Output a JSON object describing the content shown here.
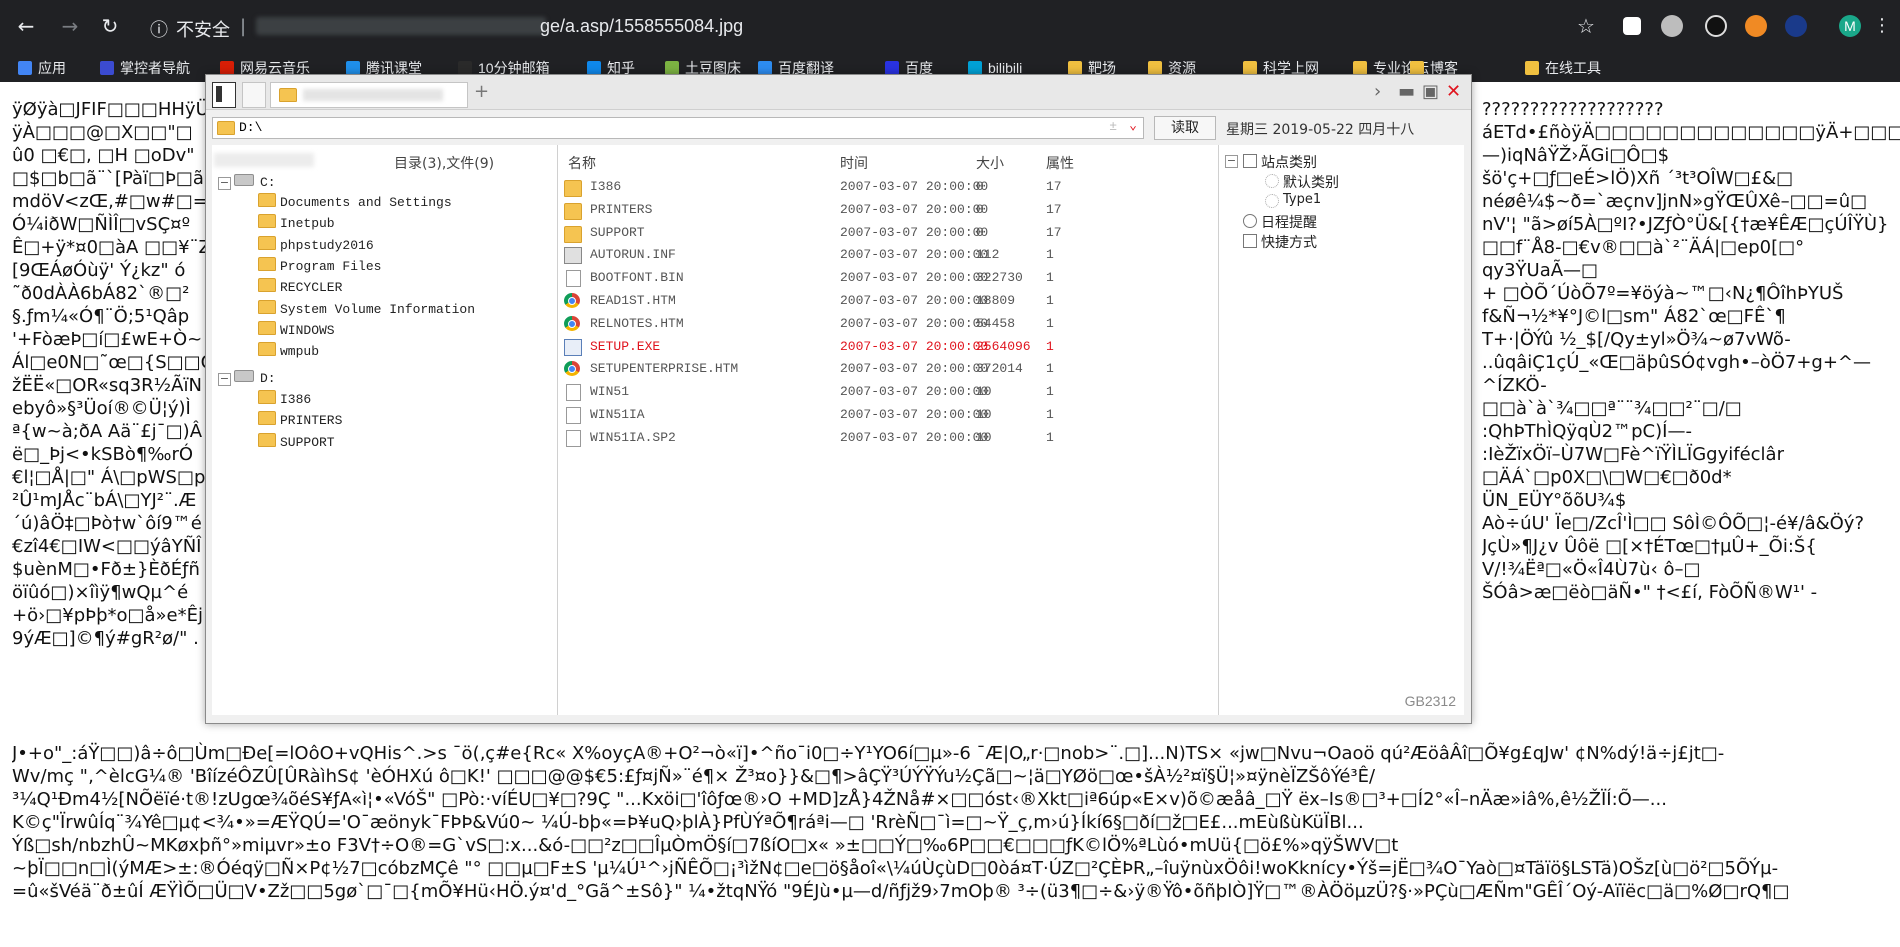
{
  "browser": {
    "security_label": "不安全",
    "url_visible": "ge/a.asp/1558555084.jpg",
    "profile_initial": "M"
  },
  "bookmarks": [
    {
      "label": "应用",
      "color": "#4285f4"
    },
    {
      "label": "掌控者导航",
      "color": "#3b4bd1"
    },
    {
      "label": "网易云音乐",
      "color": "#d81e06"
    },
    {
      "label": "腾讯课堂",
      "color": "#1f8fea"
    },
    {
      "label": "10分钟邮箱",
      "color": "#2a2a2a"
    },
    {
      "label": "知乎",
      "color": "#0f88eb"
    },
    {
      "label": "土豆图床",
      "color": "#7cb342"
    },
    {
      "label": "百度翻译",
      "color": "#2d8cf0"
    },
    {
      "label": "百度",
      "color": "#2932e1"
    },
    {
      "label": "bilibili",
      "color": "#00a1d6"
    },
    {
      "label": "靶场",
      "color": "#f0c040"
    },
    {
      "label": "资源",
      "color": "#f0c040"
    },
    {
      "label": "科学上网",
      "color": "#f0c040"
    },
    {
      "label": "专业论坛",
      "color": "#f0c040"
    },
    {
      "label": "博客",
      "color": "#f0c040"
    },
    {
      "label": "在线工具",
      "color": "#f0c040"
    }
  ],
  "garbled_left": [
    "ÿØÿà□JFIF□□□HHÿÜ",
    "ÿÀ□□□@□X□□\"□",
    "û0 □€□,  □H □oDv\"",
    "□$□b□ã¨`[Pàï□Þ□ã&",
    "mdöV<zŒ,#□w#□=",
    "Ó¼iðW□ÑÌÎ□vSÇ¤º",
    "Ê□+ÿ*¤0□àA □□¥¨Z",
    "[9ŒÁøÓùÿ' Ý¿kz\" ó",
    "˜ð0dÀÀ6bÁ82`®□²",
    "§.ƒm¼«Ó¶¨Ö;5¹Qâp",
    "'+FòæÞ□í□£wE+Ò~",
    "Ál□e0N□˜œ□{S□□Ó",
    "žËË«□OR«sq3R½ÃïN",
    "ebyô»§³Üoí®©Ü¦ý)Ì",
    "ª{w~à;ðA Aä¨£j¯□)Â",
    "ë□_Þj<•kSBò¶‰rÓ",
    "€l¦□Å|□\" Á\\□pWS□p",
    "²Û¹mJÅc¨bÁ\\□YJ²¨.Æ",
    "´ú)âÖ‡□Þò†w`ôí9™é",
    "€zî4€□IW<□□ýâYÑÎ",
    "$uènM□•Fð±}ÈðÉƒñ",
    "öïûó□)×îìÿ¶wQµ^é",
    "+ö›□¥pÞþ*o□å»e*Êj",
    "9ýÆ□]©¶ý#gR²ø/\" ."
  ],
  "garbled_right": [
    "???????????????????",
    "áETd•£ñòÿÄ□□□□□□□□□□□□□ÿÄ+□□□□□□",
    "—)iqNâŸŽ›ÃGi□Ô□$",
    "šö'ç+□ƒ□eÉ>lÖ)Xñ ´³t³OÎW□£&□",
    "",
    "néøê¼$~ð=`æçnv]jnN»gŸŒÛXê–□□=û□",
    "nV'¦ \"ã>øí5À□ºI?•JZƒÒ°Ü&[{†æ¥ÊÆ□çÚÎŸÙ}",
    "□□f¨Å8-□€v®□□à`²¨ÄÁ|□ep0[□°",
    "qy3ŸUaÃ—□",
    "+ □ÒÕ´ÚòÕ7º=¥öýà~™□‹N¿¶ÔîhÞYUŠ",
    "f&Ñ¬½*¥°J©l□sm\" Á82`œ□FÊ`¶",
    "",
    "T+·|ÖÝû ½_$[/Qy±yl»Ö¾~ø7vWõ-",
    "..ûqâiÇ1çÚ_«Œ□äþûSÓ¢vgh•–òÖ7+g+^—",
    "^ÍZKÖ-",
    "□□à`à`¾□□ª¨¨¾□□²¨□/□",
    ":QhÞThÌQÿqÙ2™pC)Í—-",
    ":IèŽïxÖï–Ù7W□Fè^ïŸÌLÏGgyiféclâr",
    "□ÄÁ`□p0X□\\□W□€□ð0d*",
    "ÜN_EÜY°õõU¾$",
    "Aò÷úU' Ïe□/ZcÎ'Ì□□ SôÌ©ÔÕ□¦-é¥/â&Öý?",
    "JçÙ»¶J¿v Ûôë □[×†ÉTœ□†µÛ+_Õi:Š{",
    "V/!¾Ëª□«Ö«Î4Ù7ù‹ ô–□",
    "ŠÓâ>æ□ëò□äÑ•\" †<£í, FòÕÑ®W¹' -"
  ],
  "garbled_bottom": [
    "J•+o\"_:áŸ□□)â÷ô□Ùm□Ðe[=lOôO+vQHis^.>s ¯ö(‚ç#e{Rc« X%oyçA®+O²¬ò«ï]•^ño¯i0□÷Y¹YO6í□µ»-6 ¯Æ|O„r·□nob>¨.□]...N)TS× «jw□Nvu¬Oaoö qú²ÆöâÂî□Õ¥g£qJw' ¢N%dý!ä÷j£jt□-",
    "Wv/mç \"‚^èlcG¼® 'BîízéÔZÛ[ÛRàìhS¢ 'èÓHXú ô□K!' □□□@@$€5:£ƒ¤jÑ»¨é¶× Ž³¤o}}&□¶>âÇŸ³ÚÝŸÝu½Çã□~¦ä□YØö□œ•šÀ½²¤ï§Ü¦»¤ÿnèÏZŠôÝé³Ê/",
    "³¼Q¹Ðm4½[NÕëïé·t®!zUgœ¾õéS¥ƒA«ì¦•«VóŠ\" □Pò:·víÉU□¥□?9Ç \"...Kxöi□'îôƒœ®›O +MD]zÅ}4ŽNå#×□□óst‹®Xkt□iª6úp«E×v)õ©æåâ_□Ÿ ëx–Is®□³+□Í2°«Î–nÄæ»iâ%,ê½ŽÏÍ:Õ—...",
    "K©ç\"ÏrwûÍq¨¾Yê□µ¢<¾•»=ÆŸQÚ='O¯æönyk¯FÞÞ&Vú0~ ¼Ú-bþ«=Þ¥uQ›þlÀ}PfÙÝªÕ¶ráªi—□ 'RrèÑ□¯ì=□~Ÿ_ç,m›ú}Íkí6§□ðí□ž□E£...mEùßùKüÏBl...",
    "Ýß□sh/nbzhÛ~MKøxþñ°»miµvr»±o F3V†÷O®=G`vS□:x...&ó-□□²z□□ÎµÒmÖ§í□7ßíO□x« »±□□Ý□‰6P□□€□□□ƒK©lÖ%ªLùó•mUü{□ö£%»qÿŠWV□t",
    "~þÏ□□n□Ì(ýMÆ>±:®Óéqÿ□Ñ×P¢½7□cóbzMÇê \"° □□µ□F±S 'µ¼Ú¹^›jÑÊÕ□¡³ìžN¢□e□ö§åoî«\\¼úÙçùD□0òá¤T·ÚZ□²ÇÈÞR„–îuÿnùxÖôi!woKknícy•Ýš=jË□¾O¯Yaò□¤Täïö§LSTä)OŠz[ù□ö²□5ÕÝµ-",
    "=û«šVéä¨ð±ûÍ ÆŸÌÕ□Ü□V•Zž□□5gø`□¯□{mÕ¥Hü‹HÖ.ý¤'d_°Gã^±Sô}\" ¼•žtqNŸó \"9ÉJù•µ—d/ñƒjž9›7mOþ® ³÷(ü3¶□÷&›ÿ®Ÿô•õñþlÒ]Ÿ□™®ÀÖöµzÜ?§·»PÇù□ÆÑm\"GÊÎ´Oý-Aïïëc□ä□%Ø□rQ¶□"
  ],
  "filemanager": {
    "address": "D:\\",
    "go_label": "读取",
    "date_text": "星期三  2019-05-22  四月十八",
    "tree_header": "目录(3),文件(9)",
    "columns": {
      "name": "名称",
      "time": "时间",
      "size": "大小",
      "attr": "属性"
    },
    "tree": {
      "c_drive": "C:",
      "c_children": [
        "Documents and Settings",
        "Inetpub",
        "phpstudy2016",
        "Program Files",
        "RECYCLER",
        "System Volume Information",
        "WINDOWS",
        "wmpub"
      ],
      "d_drive": "D:",
      "d_children": [
        "I386",
        "PRINTERS",
        "SUPPORT"
      ]
    },
    "files": [
      {
        "name": "I386",
        "time": "2007-03-07 20:00:00",
        "size": "0",
        "attr": "17",
        "icon": "folder-icon",
        "highlight": false
      },
      {
        "name": "PRINTERS",
        "time": "2007-03-07 20:00:00",
        "size": "0",
        "attr": "17",
        "icon": "folder-icon",
        "highlight": false
      },
      {
        "name": "SUPPORT",
        "time": "2007-03-07 20:00:00",
        "size": "0",
        "attr": "17",
        "icon": "folder-icon",
        "highlight": false
      },
      {
        "name": "AUTORUN.INF",
        "time": "2007-03-07 20:00:00",
        "size": "112",
        "attr": "1",
        "icon": "settings-file-icon",
        "highlight": false
      },
      {
        "name": "BOOTFONT.BIN",
        "time": "2007-03-07 20:00:00",
        "size": "322730",
        "attr": "1",
        "icon": "file-icon",
        "highlight": false
      },
      {
        "name": "READ1ST.HTM",
        "time": "2007-03-07 20:00:00",
        "size": "18809",
        "attr": "1",
        "icon": "chrome-icon",
        "highlight": false
      },
      {
        "name": "RELNOTES.HTM",
        "time": "2007-03-07 20:00:00",
        "size": "54458",
        "attr": "1",
        "icon": "chrome-icon",
        "highlight": false
      },
      {
        "name": "SETUP.EXE",
        "time": "2007-03-07 20:00:00",
        "size": "2564096",
        "attr": "1",
        "icon": "exe-icon",
        "highlight": true
      },
      {
        "name": "SETUPENTERPRISE.HTM",
        "time": "2007-03-07 20:00:00",
        "size": "372014",
        "attr": "1",
        "icon": "chrome-icon",
        "highlight": false
      },
      {
        "name": "WIN51",
        "time": "2007-03-07 20:00:00",
        "size": "10",
        "attr": "1",
        "icon": "file-icon",
        "highlight": false
      },
      {
        "name": "WIN51IA",
        "time": "2007-03-07 20:00:00",
        "size": "10",
        "attr": "1",
        "icon": "file-icon",
        "highlight": false
      },
      {
        "name": "WIN51IA.SP2",
        "time": "2007-03-07 20:00:00",
        "size": "10",
        "attr": "1",
        "icon": "file-icon",
        "highlight": false
      }
    ],
    "right_tree": {
      "root": "站点类别",
      "children": [
        "默认类别",
        "Type1"
      ],
      "extras": [
        "日程提醒",
        "快捷方式"
      ]
    },
    "encoding": "GB2312",
    "highlight_color": "#e0141e"
  }
}
